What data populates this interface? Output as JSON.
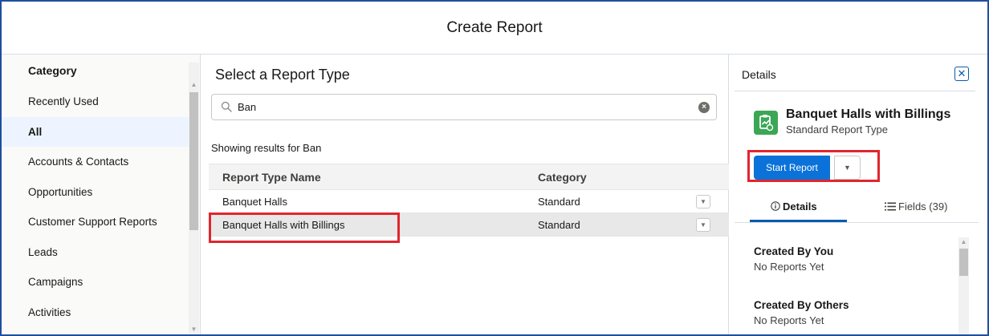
{
  "modal": {
    "title": "Create Report"
  },
  "categories": {
    "heading": "Category",
    "items": [
      {
        "label": "Recently Used",
        "selected": false
      },
      {
        "label": "All",
        "selected": true
      },
      {
        "label": "Accounts & Contacts",
        "selected": false
      },
      {
        "label": "Opportunities",
        "selected": false
      },
      {
        "label": "Customer Support Reports",
        "selected": false
      },
      {
        "label": "Leads",
        "selected": false
      },
      {
        "label": "Campaigns",
        "selected": false
      },
      {
        "label": "Activities",
        "selected": false
      }
    ]
  },
  "report_types": {
    "heading": "Select a Report Type",
    "search": {
      "value": "Ban",
      "placeholder": ""
    },
    "results_text": "Showing results for Ban",
    "columns": [
      "Report Type Name",
      "Category"
    ],
    "rows": [
      {
        "name": "Banquet Halls",
        "category": "Standard",
        "selected": false
      },
      {
        "name": "Banquet Halls with Billings",
        "category": "Standard",
        "selected": true
      }
    ]
  },
  "details": {
    "title": "Details",
    "report_name": "Banquet Halls with Billings",
    "report_type": "Standard Report Type",
    "start_button": "Start Report",
    "tabs": {
      "details": "Details",
      "fields": "Fields (39)"
    },
    "sections": [
      {
        "heading": "Created By You",
        "value": "No Reports Yet"
      },
      {
        "heading": "Created By Others",
        "value": "No Reports Yet"
      }
    ]
  },
  "colors": {
    "brand_button": "#0b72d9",
    "highlight": "#e0262e",
    "report_icon": "#3ba755",
    "selected_category": "#eef4ff"
  }
}
